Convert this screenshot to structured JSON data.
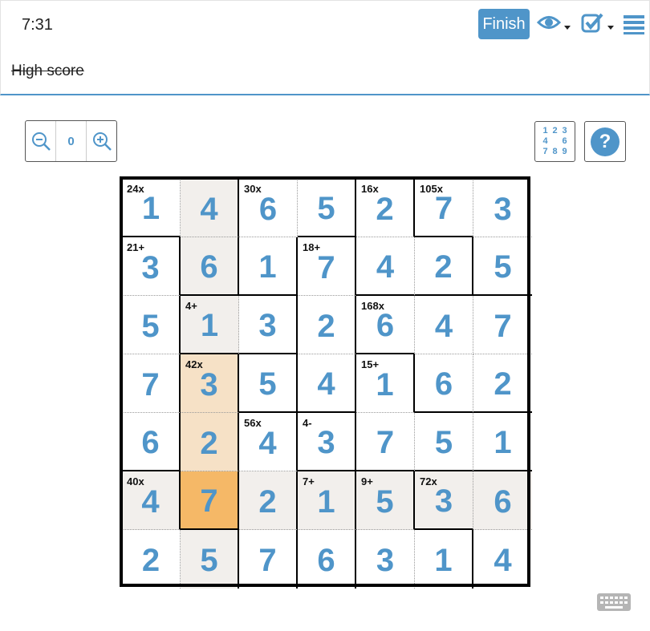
{
  "header": {
    "timer": "7:31",
    "finish_label": "Finish"
  },
  "subheader": {
    "high_score_label": "High score"
  },
  "icons": {
    "eye": "eye-icon",
    "check": "checkbox-check-icon",
    "menu": "hamburger-menu-icon",
    "zoom_out": "zoom-out-icon",
    "zoom_in": "zoom-in-icon",
    "help": "question-icon",
    "keyboard": "keyboard-icon"
  },
  "toolbar": {
    "zoom_value": "0",
    "candidates": [
      "1",
      "2",
      "3",
      "4",
      "",
      "6",
      "7",
      "8",
      "9"
    ],
    "help_label": "?"
  },
  "colors": {
    "accent": "#4f95c9",
    "highlight": "#f2efec",
    "cage_highlight": "#f6e1c6",
    "selected": "#f5b867"
  },
  "puzzle": {
    "size": 7,
    "values": [
      [
        1,
        4,
        6,
        5,
        2,
        7,
        3
      ],
      [
        3,
        6,
        1,
        7,
        4,
        2,
        5
      ],
      [
        5,
        1,
        3,
        2,
        6,
        4,
        7
      ],
      [
        7,
        3,
        5,
        4,
        1,
        6,
        2
      ],
      [
        6,
        2,
        4,
        3,
        7,
        5,
        1
      ],
      [
        4,
        7,
        2,
        1,
        5,
        3,
        6
      ],
      [
        2,
        5,
        7,
        6,
        3,
        1,
        4
      ]
    ],
    "clues": [
      {
        "r": 0,
        "c": 0,
        "text": "24x"
      },
      {
        "r": 0,
        "c": 2,
        "text": "30x"
      },
      {
        "r": 0,
        "c": 4,
        "text": "16x"
      },
      {
        "r": 0,
        "c": 5,
        "text": "105x"
      },
      {
        "r": 1,
        "c": 0,
        "text": "21+"
      },
      {
        "r": 1,
        "c": 3,
        "text": "18+"
      },
      {
        "r": 2,
        "c": 1,
        "text": "4+"
      },
      {
        "r": 2,
        "c": 4,
        "text": "168x"
      },
      {
        "r": 3,
        "c": 1,
        "text": "42x"
      },
      {
        "r": 3,
        "c": 4,
        "text": "15+"
      },
      {
        "r": 4,
        "c": 2,
        "text": "56x"
      },
      {
        "r": 4,
        "c": 3,
        "text": "4-"
      },
      {
        "r": 5,
        "c": 0,
        "text": "40x"
      },
      {
        "r": 5,
        "c": 3,
        "text": "7+"
      },
      {
        "r": 5,
        "c": 4,
        "text": "9+"
      },
      {
        "r": 5,
        "c": 5,
        "text": "72x"
      }
    ],
    "cages": [
      [
        0,
        0,
        1,
        1,
        2,
        3,
        3
      ],
      [
        4,
        0,
        1,
        5,
        2,
        2,
        3
      ],
      [
        4,
        6,
        6,
        5,
        7,
        7,
        7
      ],
      [
        4,
        8,
        9,
        5,
        10,
        7,
        7
      ],
      [
        4,
        8,
        11,
        12,
        10,
        10,
        10
      ],
      [
        13,
        8,
        11,
        14,
        15,
        16,
        16
      ],
      [
        13,
        13,
        11,
        14,
        15,
        15,
        16
      ]
    ],
    "highlight": [
      [
        0,
        1
      ],
      [
        1,
        1
      ],
      [
        2,
        1
      ],
      [
        3,
        1
      ],
      [
        4,
        1
      ],
      [
        5,
        1
      ],
      [
        6,
        1
      ],
      [
        5,
        0
      ],
      [
        5,
        2
      ],
      [
        5,
        3
      ],
      [
        5,
        4
      ],
      [
        5,
        5
      ],
      [
        5,
        6
      ]
    ],
    "cage_highlight": [
      [
        3,
        1
      ],
      [
        4,
        1
      ]
    ],
    "selected": {
      "r": 5,
      "c": 1
    }
  }
}
